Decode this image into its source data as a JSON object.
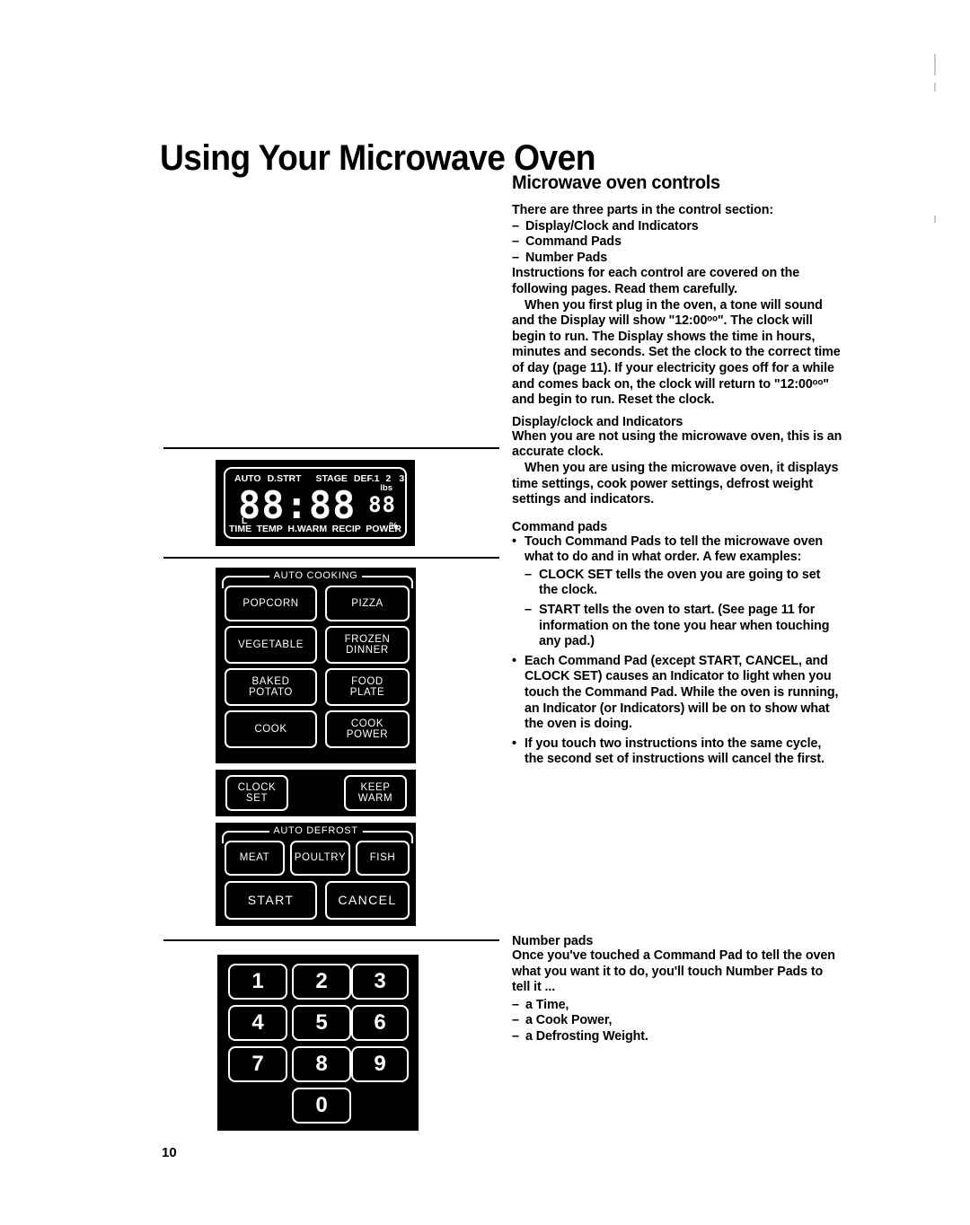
{
  "page": {
    "title": "Using Your Microwave Oven",
    "page_number": "10"
  },
  "content": {
    "section_heading": "Microwave oven controls",
    "intro_lead": "There are three parts in the control section:",
    "intro_items": [
      "Display/Clock and Indicators",
      "Command Pads",
      "Number Pads"
    ],
    "intro_para1": "Instructions for each control are covered on the following pages. Read them carefully.",
    "intro_para2": "When you first plug in the oven, a tone will sound and the Display will show \"12:00ᵒᵒ\". The clock will begin to run. The Display shows the time in hours, minutes and seconds. Set the clock to the correct time of day (page 11). If your electricity goes off for a while and comes back on, the clock will return to \"12:00ᵒᵒ\" and begin to run. Reset the clock.",
    "display_heading": "Display/clock and Indicators",
    "display_para1": "When you are not using the microwave oven, this is an accurate clock.",
    "display_para2": "When you are using the microwave oven, it displays time settings, cook power settings, defrost weight settings and indicators.",
    "command_heading": "Command pads",
    "command_bullet1": "Touch Command Pads to tell the microwave oven what to do and in what order. A few examples:",
    "command_sub1": "CLOCK SET tells the oven you are going to set the clock.",
    "command_sub2": "START tells the oven to start. (See page 11 for information on the tone you hear when touching any pad.)",
    "command_bullet2": "Each Command Pad (except START, CANCEL, and CLOCK SET) causes an Indicator to light when you touch the Command Pad. While the oven is running, an Indicator (or Indicators) will be on to show what the oven is doing.",
    "command_bullet3": "If you touch two instructions into the same cycle, the second set of instructions will cancel the first.",
    "number_heading": "Number pads",
    "number_para": "Once you've touched a Command Pad to tell the oven what you want it to do, you'll touch Number Pads to tell it ...",
    "number_items": [
      "a Time,",
      "a Cook Power,",
      "a Defrosting Weight."
    ]
  },
  "display_panel": {
    "indicators_top": [
      "AUTO",
      "D.STRT",
      "STAGE",
      "DEF.1",
      "2",
      "3"
    ],
    "indicators_bottom": [
      "TIME",
      "TEMP",
      "H.WARM",
      "RECIP",
      "POWER"
    ],
    "digits": "88:88",
    "small_digits": "88",
    "unit_lbs": "lbs",
    "unit_pct": "%",
    "indicator_l": "L"
  },
  "auto_cooking": {
    "group_label": "AUTO COOKING",
    "keys": [
      {
        "label": "POPCORN"
      },
      {
        "label": "PIZZA"
      },
      {
        "label": "VEGETABLE"
      },
      {
        "label": "FROZEN\nDINNER",
        "line1": "FROZEN",
        "line2": "DINNER"
      },
      {
        "label": "BAKED\nPOTATO",
        "line1": "BAKED",
        "line2": "POTATO"
      },
      {
        "label": "FOOD\nPLATE",
        "line1": "FOOD",
        "line2": "PLATE"
      },
      {
        "label": "COOK"
      },
      {
        "label": "COOK\nPOWER",
        "line1": "COOK",
        "line2": "POWER"
      }
    ]
  },
  "clock_row": {
    "clock_set_line1": "CLOCK",
    "clock_set_line2": "SET",
    "keep_warm_line1": "KEEP",
    "keep_warm_line2": "WARM"
  },
  "auto_defrost": {
    "group_label": "AUTO DEFROST",
    "keys": [
      "MEAT",
      "POULTRY",
      "FISH"
    ],
    "start": "START",
    "cancel": "CANCEL"
  },
  "number_pad": {
    "keys": [
      "1",
      "2",
      "3",
      "4",
      "5",
      "6",
      "7",
      "8",
      "9",
      "0"
    ]
  },
  "colors": {
    "ink": "#000000",
    "paper": "#ffffff",
    "panel": "#000000",
    "key_stroke": "#ffffff"
  }
}
